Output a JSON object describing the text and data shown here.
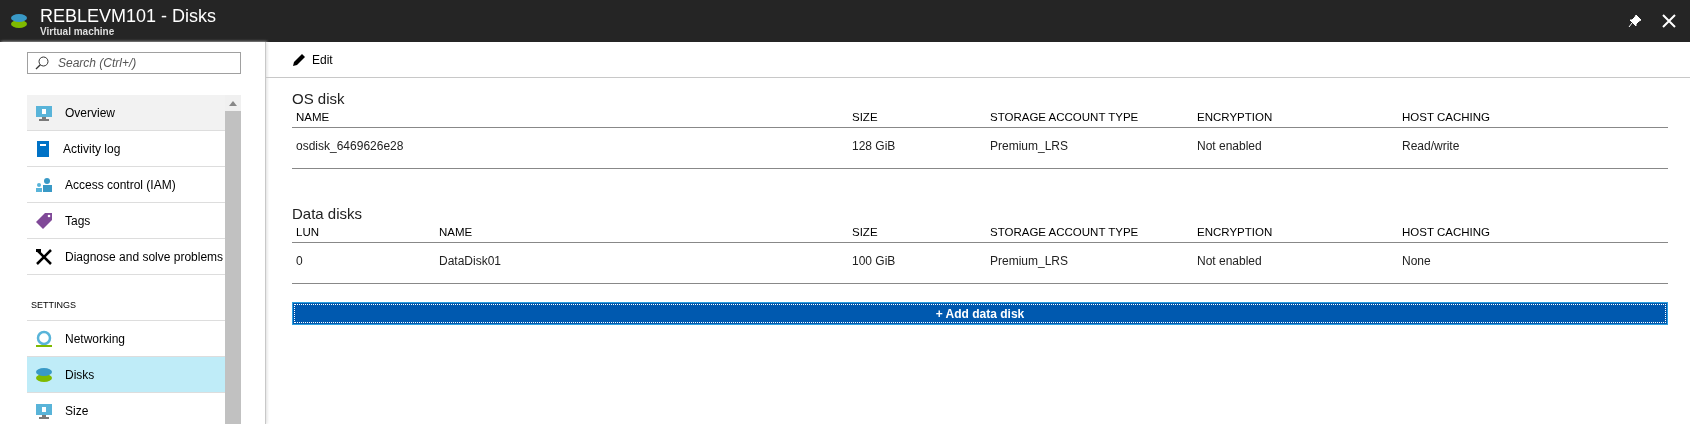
{
  "window": {
    "title": "REBLEVM101 - Disks",
    "subtitle": "Virtual machine"
  },
  "sidebar": {
    "search": {
      "placeholder": "Search (Ctrl+/)"
    },
    "items": [
      {
        "kind": "item",
        "label": "Overview",
        "selected": false,
        "hovered": true
      },
      {
        "kind": "item",
        "label": "Activity log",
        "selected": false,
        "hovered": false
      },
      {
        "kind": "item",
        "label": "Access control (IAM)",
        "selected": false,
        "hovered": false
      },
      {
        "kind": "item",
        "label": "Tags",
        "selected": false,
        "hovered": false
      },
      {
        "kind": "item",
        "label": "Diagnose and solve problems",
        "selected": false,
        "hovered": false
      },
      {
        "kind": "section",
        "label": "SETTINGS"
      },
      {
        "kind": "item",
        "label": "Networking",
        "selected": false,
        "hovered": false
      },
      {
        "kind": "item",
        "label": "Disks",
        "selected": true,
        "hovered": false
      },
      {
        "kind": "item",
        "label": "Size",
        "selected": false,
        "hovered": false
      }
    ]
  },
  "toolbar": {
    "edit": "Edit"
  },
  "os_disk": {
    "title": "OS disk",
    "columns": [
      "NAME",
      "SIZE",
      "STORAGE ACCOUNT TYPE",
      "ENCRYPTION",
      "HOST CACHING"
    ],
    "rows": [
      [
        "osdisk_6469626e28",
        "128 GiB",
        "Premium_LRS",
        "Not enabled",
        "Read/write"
      ]
    ]
  },
  "data_disks": {
    "title": "Data disks",
    "columns": [
      "LUN",
      "NAME",
      "SIZE",
      "STORAGE ACCOUNT TYPE",
      "ENCRYPTION",
      "HOST CACHING"
    ],
    "rows": [
      [
        "0",
        "DataDisk01",
        "100 GiB",
        "Premium_LRS",
        "Not enabled",
        "None"
      ]
    ]
  },
  "add_button": "+ Add data disk"
}
